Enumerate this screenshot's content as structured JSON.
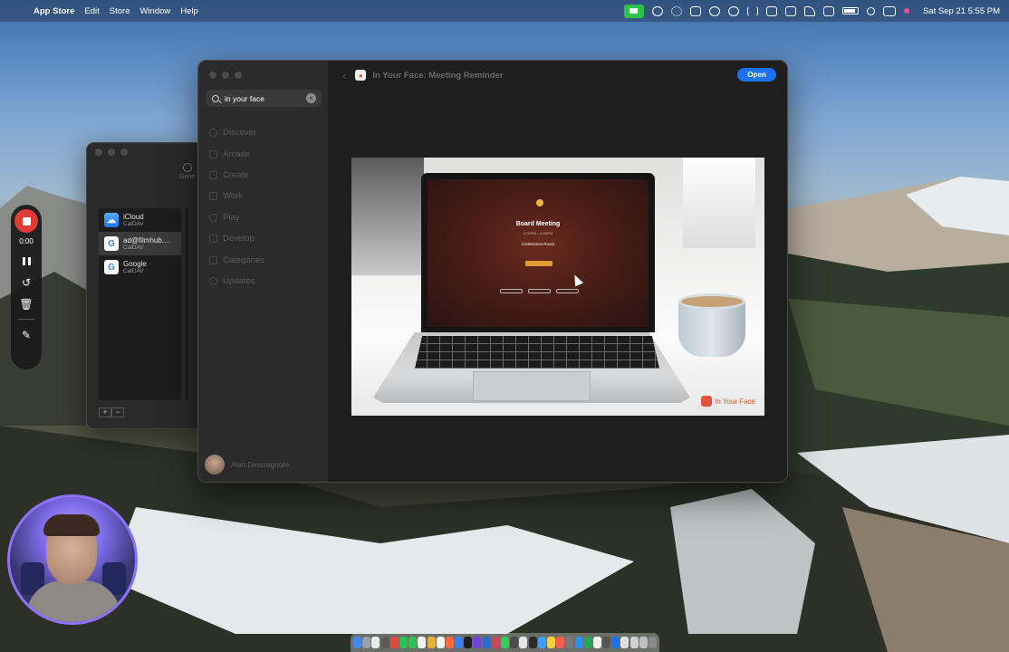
{
  "menubar": {
    "apple_glyph": "",
    "app_name": "App Store",
    "menus": [
      "Edit",
      "Store",
      "Window",
      "Help"
    ],
    "clock": "Sat Sep 21  5:55 PM",
    "status_icons": [
      "facetime-icon",
      "onepassword-icon",
      "gear-icon",
      "notion-icon",
      "screens-icon",
      "chat-icon",
      "fork-icon",
      "window-icon",
      "scanner-icon",
      "pen-icon",
      "display-icon",
      "battery-icon",
      "search-icon",
      "control-center-icon",
      "siri-icon"
    ]
  },
  "calendar_accounts": {
    "section_label": "Gene",
    "accounts": [
      {
        "name": "iCloud",
        "type": "CalDAV",
        "icon": "icloud-icon"
      },
      {
        "name": "ad@filmhub....",
        "type": "CalDAV",
        "icon": "google-icon"
      },
      {
        "name": "Google",
        "type": "CalDAV",
        "icon": "google-icon"
      }
    ],
    "add_label": "+",
    "remove_label": "−"
  },
  "recorder": {
    "elapsed": "0:00",
    "controls": [
      "stop-icon",
      "pause-icon",
      "restart-icon",
      "trash-icon",
      "pen-icon"
    ]
  },
  "appstore": {
    "search": {
      "value": "in your face"
    },
    "nav": [
      "Discover",
      "Arcade",
      "Create",
      "Work",
      "Play",
      "Develop",
      "Categories",
      "Updates"
    ],
    "user_name": "Alan Descragnolle",
    "app_title": "In Your Face: Meeting Reminder",
    "open_label": "Open",
    "screenshot": {
      "meeting_title": "Board Meeting",
      "meeting_time": "3:00PM – 4:00PM",
      "location": "Conference Room",
      "brand": "In Your Face"
    }
  },
  "colors": {
    "accent_blue": "#1a73ee",
    "record_red": "#e23a35",
    "facetime_green": "#2fc24b",
    "webcam_ring": "#8f70ff"
  }
}
